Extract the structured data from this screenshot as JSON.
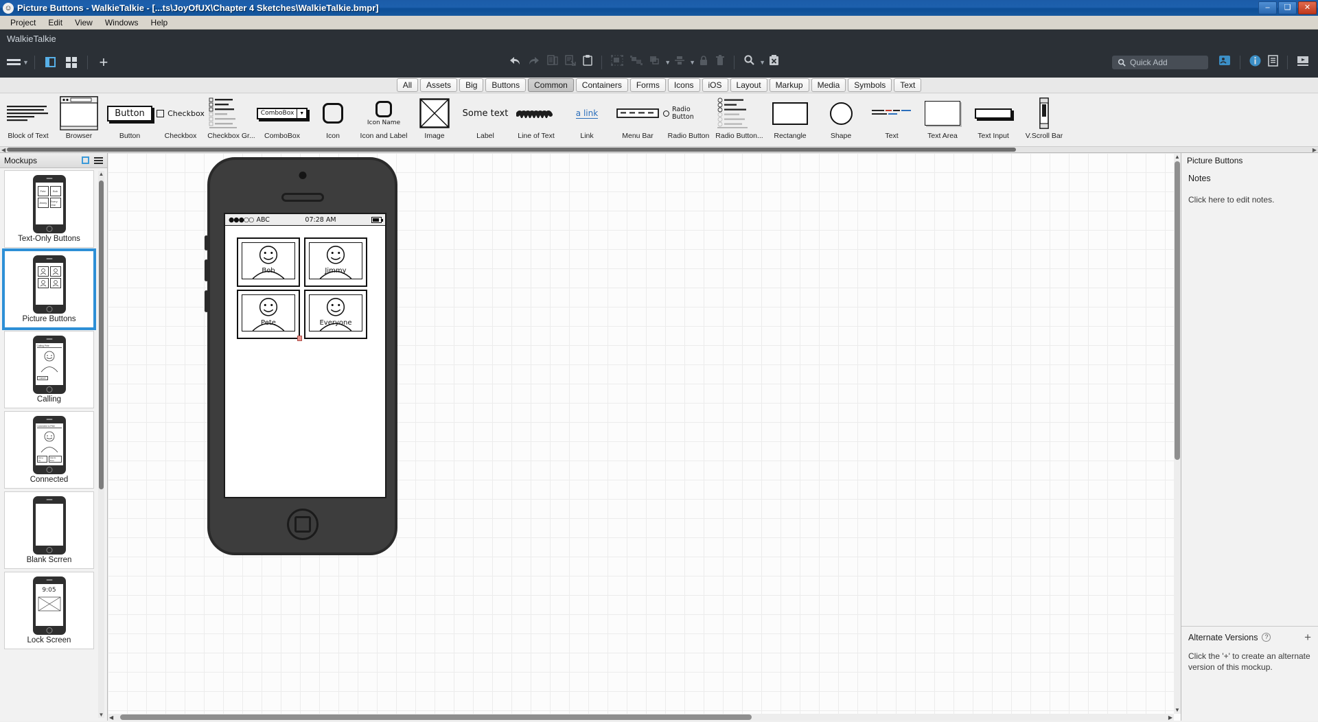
{
  "titlebar": {
    "title": "Picture Buttons - WalkieTalkie - [...ts\\JoyOfUX\\Chapter 4 Sketches\\WalkieTalkie.bmpr]",
    "app_icon": "balsamiq-face-icon",
    "minimize": "–",
    "maximize": "❑",
    "close": "✕"
  },
  "menubar": {
    "items": [
      "Project",
      "Edit",
      "View",
      "Windows",
      "Help"
    ]
  },
  "header": {
    "project_name": "WalkieTalkie",
    "quick_add_placeholder": "Quick Add",
    "tools": [
      "undo-icon",
      "redo-icon",
      "copy-icon",
      "cut-icon",
      "paste-icon",
      "group-icon",
      "ungroup-icon",
      "arrange-icon",
      "align-icon",
      "lock-icon",
      "delete-icon",
      "zoom-icon",
      "clear-icon"
    ],
    "right_icons": [
      "share-icon",
      "info-icon",
      "notes-icon",
      "present-icon"
    ]
  },
  "categories": {
    "items": [
      "All",
      "Assets",
      "Big",
      "Buttons",
      "Common",
      "Containers",
      "Forms",
      "Icons",
      "iOS",
      "Layout",
      "Markup",
      "Media",
      "Symbols",
      "Text"
    ],
    "active": "Common"
  },
  "palette": {
    "items": [
      {
        "label": "Block of Text",
        "art": "block-of-text"
      },
      {
        "label": "Browser",
        "art": "browser"
      },
      {
        "label": "Button",
        "art": "button",
        "sample_text": "Button"
      },
      {
        "label": "Checkbox",
        "art": "checkbox",
        "sample_text": "Checkbox"
      },
      {
        "label": "Checkbox Gr...",
        "art": "checkbox-group"
      },
      {
        "label": "ComboBox",
        "art": "combobox",
        "sample_text": "ComboBox"
      },
      {
        "label": "Icon",
        "art": "icon"
      },
      {
        "label": "Icon and Label",
        "art": "icon-and-label",
        "sample_text": "Icon Name"
      },
      {
        "label": "Image",
        "art": "image"
      },
      {
        "label": "Label",
        "art": "label",
        "sample_text": "Some text"
      },
      {
        "label": "Line of Text",
        "art": "line-of-text"
      },
      {
        "label": "Link",
        "art": "link",
        "sample_text": "a link"
      },
      {
        "label": "Menu Bar",
        "art": "menu-bar"
      },
      {
        "label": "Radio Button",
        "art": "radio-button",
        "sample_text": "Radio Button"
      },
      {
        "label": "Radio Button...",
        "art": "radio-button-group"
      },
      {
        "label": "Rectangle",
        "art": "rectangle"
      },
      {
        "label": "Shape",
        "art": "shape"
      },
      {
        "label": "Text",
        "art": "text"
      },
      {
        "label": "Text Area",
        "art": "text-area"
      },
      {
        "label": "Text Input",
        "art": "text-input"
      },
      {
        "label": "V.Scroll Bar",
        "art": "vscroll-bar"
      }
    ]
  },
  "sidebar": {
    "title": "Mockups",
    "items": [
      {
        "name": "Text-Only Buttons",
        "selected": false,
        "kind": "grid",
        "cells": [
          "Pete",
          "Bob",
          "Jimmy",
          "Every One"
        ]
      },
      {
        "name": "Picture Buttons",
        "selected": true,
        "kind": "grid-photo",
        "cells": [
          "Bob",
          "Jimmy",
          "Pete",
          "Everyone"
        ]
      },
      {
        "name": "Calling",
        "selected": false,
        "kind": "portrait",
        "header": "Calling Pete",
        "footer": [
          "Cancel"
        ]
      },
      {
        "name": "Connected",
        "selected": false,
        "kind": "portrait",
        "header": "Connected to Pete",
        "footer": [
          "Hang Up",
          "Hands Free"
        ]
      },
      {
        "name": "Blank Scrren",
        "selected": false,
        "kind": "blank"
      },
      {
        "name": "Lock Screen",
        "selected": false,
        "kind": "clock",
        "time": "9:05"
      }
    ]
  },
  "canvas": {
    "phone": {
      "status_bar": {
        "signal": "●●●○○",
        "carrier": "ABC",
        "time": "07:28 AM",
        "battery": "battery-icon"
      },
      "buttons": [
        {
          "label": "Bob"
        },
        {
          "label": "Jimmy"
        },
        {
          "label": "Pete"
        },
        {
          "label": "Everyone"
        }
      ]
    }
  },
  "rightpanel": {
    "title": "Picture Buttons",
    "notes_heading": "Notes",
    "notes_placeholder": "Click here to edit notes.",
    "alternate_heading": "Alternate Versions",
    "alternate_help": "?",
    "alternate_add": "+",
    "alternate_body": "Click the '+' to create an alternate version of this mockup."
  },
  "colors": {
    "title_blue": "#1d60ad",
    "header_dark": "#2b3036",
    "accent_blue": "#2d8fd6",
    "selection_pink": "#e8958f"
  }
}
